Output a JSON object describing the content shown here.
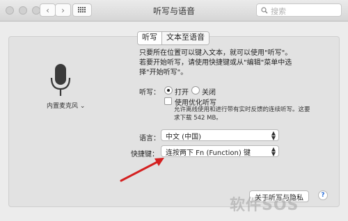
{
  "window": {
    "title": "听写与语音"
  },
  "toolbar": {
    "back_icon": "‹",
    "forward_icon": "›",
    "search_placeholder": "搜索"
  },
  "tabs": [
    {
      "label": "听写",
      "selected": true
    },
    {
      "label": "文本至语音",
      "selected": false
    }
  ],
  "microphone": {
    "label": "内置麦克风 ⌄"
  },
  "dictation": {
    "intro": "只要所在位置可以键入文本，就可以使用\"听写\"。若要开始听写，请使用快捷键或从\"编辑\"菜单中选择\"开始听写\"。",
    "label": "听写：",
    "on_label": "打开",
    "off_label": "关闭",
    "selected": "on",
    "enhanced_label": "使用优化听写",
    "enhanced_checked": false,
    "enhanced_note": "允许离线使用和进行带有实时反馈的连续听写。这要求下载 542 MB。"
  },
  "language": {
    "label": "语言：",
    "value": "中文 (中国)"
  },
  "shortcut": {
    "label": "快捷键：",
    "value": "连按两下 Fn (Function) 键"
  },
  "footer": {
    "about_button": "关于听写与隐私",
    "help": "?"
  },
  "watermark": "软件SOS"
}
